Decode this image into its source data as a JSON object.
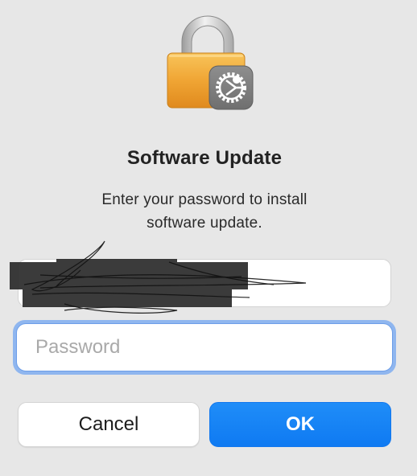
{
  "dialog": {
    "title": "Software Update",
    "message_line1": "Enter your password to install",
    "message_line2": "software update."
  },
  "fields": {
    "username_value": "",
    "password_placeholder": "Password"
  },
  "buttons": {
    "cancel_label": "Cancel",
    "ok_label": "OK"
  },
  "icons": {
    "lock": "lock-icon",
    "gear_badge": "gear-badge-icon"
  },
  "colors": {
    "accent": "#1482f5",
    "lock_body": "#f0a93a",
    "focus_ring": "#8fb6ef"
  }
}
